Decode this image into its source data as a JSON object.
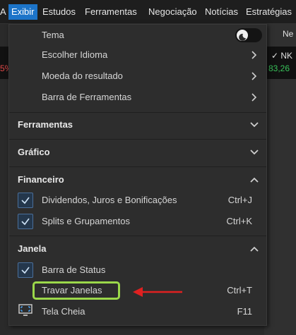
{
  "menubar": {
    "items": [
      "A",
      "Exibir",
      "Estudos",
      "Ferramentas",
      "Negociação",
      "Notícias",
      "Estratégias"
    ]
  },
  "background": {
    "right_label": "Ne",
    "ticker": "NK",
    "value": "83,26",
    "left_value": "5%"
  },
  "menu": {
    "tema": "Tema",
    "idioma": "Escolher Idioma",
    "moeda": "Moeda do resultado",
    "barra_ferramentas": "Barra de Ferramentas",
    "sections": {
      "ferramentas": "Ferramentas",
      "grafico": "Gráfico",
      "financeiro": "Financeiro",
      "janela": "Janela"
    },
    "dividendos": {
      "label": "Dividendos, Juros e Bonificações",
      "shortcut": "Ctrl+J"
    },
    "splits": {
      "label": "Splits e Grupamentos",
      "shortcut": "Ctrl+K"
    },
    "barra_status": {
      "label": "Barra de Status"
    },
    "travar": {
      "label": "Travar Janelas",
      "shortcut": "Ctrl+T"
    },
    "tela_cheia": {
      "label": "Tela Cheia",
      "shortcut": "F11"
    }
  },
  "colors": {
    "accent": "#1c74c9",
    "highlight": "#9bd84a",
    "arrow": "#e02020",
    "positive": "#38c35a",
    "negative": "#e04848"
  }
}
